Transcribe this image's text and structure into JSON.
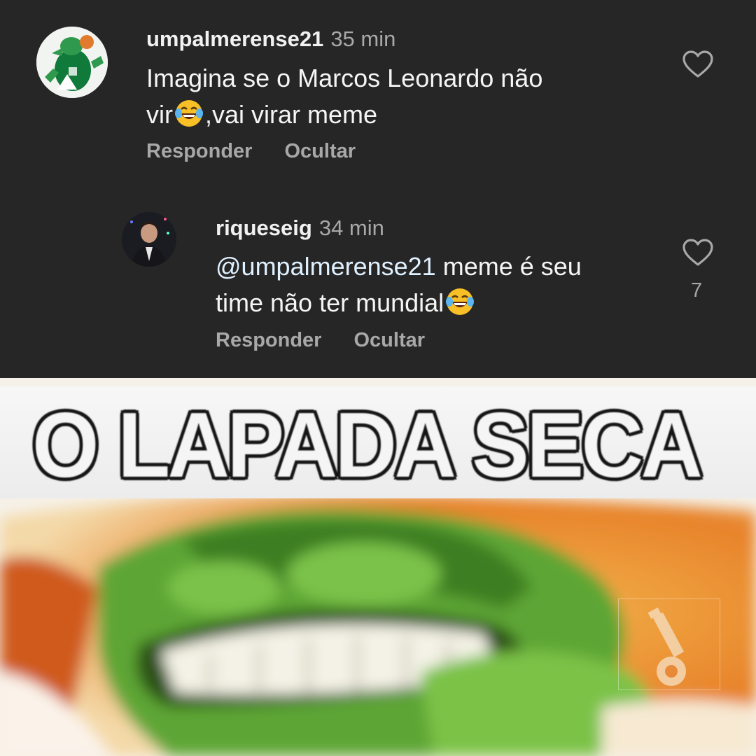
{
  "comments": [
    {
      "username": "umpalmerense21",
      "time": "35 min",
      "text_line1": "Imagina se o Marcos Leonardo não",
      "text_line2_before": "vir",
      "text_line2_after": ",vai virar meme",
      "emoji": "face-with-tears-of-joy",
      "reply_label": "Responder",
      "hide_label": "Ocultar",
      "likes": ""
    },
    {
      "username": "riqueseig",
      "time": "34 min",
      "mention": "@umpalmerense21",
      "text_line1_after": " meme é seu",
      "text_line2_before": "time não ter mundial",
      "emoji": "face-with-tears-of-joy",
      "reply_label": "Responder",
      "hide_label": "Ocultar",
      "likes": "7"
    }
  ],
  "meme": {
    "caption": "O LAPADA SECA",
    "watermark_icon": "whistle-icon"
  },
  "colors": {
    "background": "#262626",
    "primary_text": "#f5f5f5",
    "secondary_text": "#a8a8a8"
  }
}
